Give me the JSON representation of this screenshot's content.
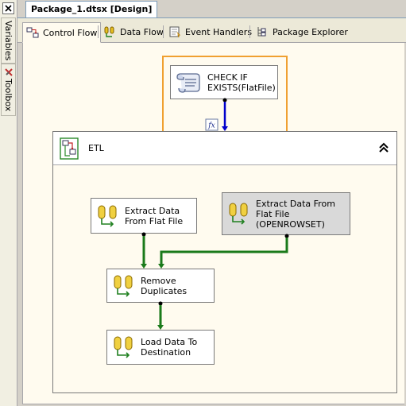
{
  "document_tab": {
    "title": "Package_1.dtsx [Design]"
  },
  "side_tabs": {
    "variables": "Variables",
    "toolbox": "Toolbox"
  },
  "designer_tabs": [
    {
      "label": "Control Flow",
      "active": true
    },
    {
      "label": "Data Flow",
      "active": false
    },
    {
      "label": "Event Handlers",
      "active": false
    },
    {
      "label": "Package Explorer",
      "active": false
    }
  ],
  "tasks": {
    "check_if_exists": "CHECK IF EXISTS(FlatFile)",
    "expression_badge": "fx"
  },
  "container": {
    "title": "ETL"
  },
  "data_tasks": {
    "extract_flat": "Extract Data From Flat File",
    "extract_openrowset": "Extract Data From Flat File (OPENROWSET)",
    "remove_duplicates": "Remove Duplicates",
    "load": "Load Data To Destination"
  },
  "colors": {
    "selection": "#f0a030",
    "precedence_success": "#1a7a1a",
    "precedence_expression": "#0000cc",
    "canvas": "#fffbef"
  }
}
